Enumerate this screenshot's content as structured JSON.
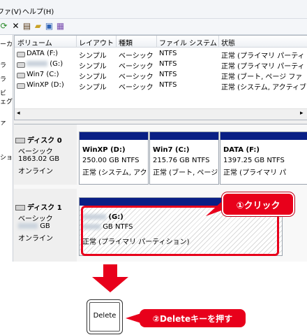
{
  "menu": {
    "items": [
      "ファ(V)",
      "ヘルプ(H)"
    ]
  },
  "tree": {
    "items": [
      "ーカ",
      "ラ",
      "ラ",
      "ビ",
      "ェグ",
      "ァ",
      "ショ"
    ]
  },
  "volume_table": {
    "columns": [
      "ボリューム",
      "レイアウト",
      "種類",
      "ファイル システム",
      "状態"
    ],
    "rows": [
      {
        "volume": "DATA (F:)",
        "layout": "シンプル",
        "type": "ベーシック",
        "fs": "NTFS",
        "status": "正常 (プライマリ パーティ"
      },
      {
        "volume": "(G:)",
        "layout": "シンプル",
        "type": "ベーシック",
        "fs": "NTFS",
        "status": "正常 (プライマリ パーティ"
      },
      {
        "volume": "Win7 (C:)",
        "layout": "シンプル",
        "type": "ベーシック",
        "fs": "NTFS",
        "status": "正常 (ブート, ページ ファ"
      },
      {
        "volume": "WinXP (D:)",
        "layout": "シンプル",
        "type": "ベーシック",
        "fs": "NTFS",
        "status": "正常 (システム, アクティブ"
      }
    ]
  },
  "disk0": {
    "title": "ディスク 0",
    "type": "ベーシック",
    "size": "1863.02 GB",
    "status": "オンライン",
    "partitions": [
      {
        "name": "WinXP  (D:)",
        "size": "250.00 GB NTFS",
        "status": "正常 (システム, アク"
      },
      {
        "name": "Win7  (C:)",
        "size": "215.76 GB NTFS",
        "status": "正常 (ブート, ページ"
      },
      {
        "name": "DATA  (F:)",
        "size": "1397.25 GB NTFS",
        "status": "正常 (プライマリ パ"
      }
    ]
  },
  "disk1": {
    "title": "ディスク 1",
    "type": "ベーシック",
    "size": "GB",
    "status": "オンライン",
    "partition": {
      "name": "(G:)",
      "size": "GB NTFS",
      "status": "正常 (プライマリ パーティション)"
    }
  },
  "annotations": {
    "step1": "①クリック",
    "key": "Delete",
    "step2": "②Deleteキーを押す"
  },
  "colors": {
    "accent_red": "#e8001b",
    "partition_bar": "#0a1f85"
  }
}
